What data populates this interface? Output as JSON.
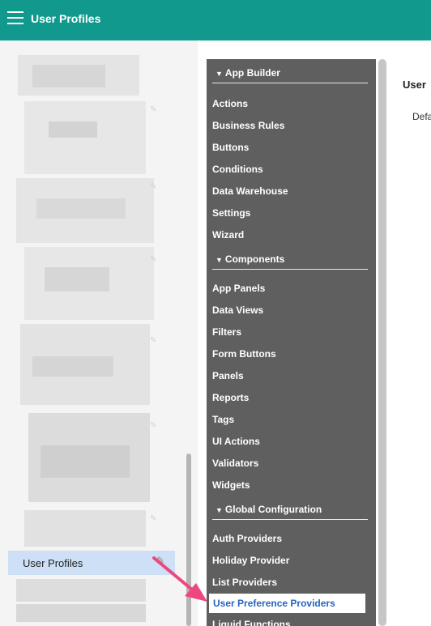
{
  "header": {
    "title": "User Profiles",
    "menu_icon": "hamburger-icon"
  },
  "left_panel": {
    "selected_item": "User Profiles",
    "edit_icon": "pencil-icon"
  },
  "menu": {
    "sections": [
      {
        "label": "App Builder",
        "items": [
          "Actions",
          "Business Rules",
          "Buttons",
          "Conditions",
          "Data Warehouse",
          "Settings",
          "Wizard"
        ]
      },
      {
        "label": "Components",
        "items": [
          "App Panels",
          "Data Views",
          "Filters",
          "Form Buttons",
          "Panels",
          "Reports",
          "Tags",
          "UI Actions",
          "Validators",
          "Widgets"
        ]
      },
      {
        "label": "Global Configuration",
        "items": [
          "Auth Providers",
          "Holiday Provider",
          "List Providers",
          "User Preference Providers",
          "Liquid Functions"
        ]
      }
    ],
    "active_item": "User Preference Providers"
  },
  "content": {
    "title": "User",
    "text": "Defa"
  },
  "colors": {
    "topbar": "#12998d",
    "menu_bg": "#5f5f5f",
    "selected_row": "#cde0f5",
    "active_text": "#2563c0",
    "arrow": "#ee4680"
  }
}
